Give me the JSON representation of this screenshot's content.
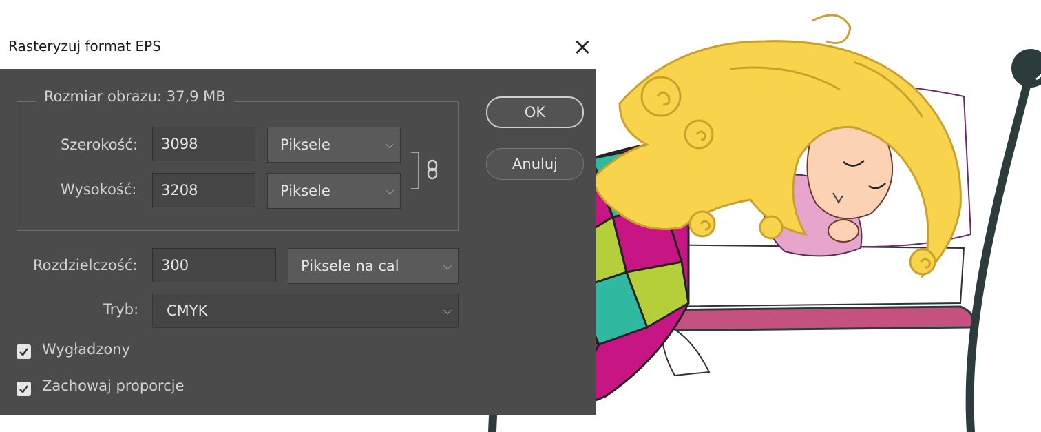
{
  "dialog": {
    "title": "Rasteryzuj format EPS",
    "ok_label": "OK",
    "cancel_label": "Anuluj",
    "image_size_label": "Rozmiar obrazu: 37,9 MB",
    "width": {
      "label": "Szerokość:",
      "value": "3098",
      "unit": "Piksele"
    },
    "height": {
      "label": "Wysokość:",
      "value": "3208",
      "unit": "Piksele"
    },
    "resolution": {
      "label": "Rozdzielczość:",
      "value": "300",
      "unit": "Piksele na cal"
    },
    "mode": {
      "label": "Tryb:",
      "value": "CMYK"
    },
    "anti_aliased": {
      "label": "Wygładzony",
      "checked": true
    },
    "constrain_proportions": {
      "label": "Zachowaj proporcje",
      "checked": true
    }
  },
  "icons": {
    "close": "close-icon",
    "link": "chain-link-icon",
    "dropdown": "chevron-down-icon",
    "check": "checkmark-icon"
  },
  "colors": {
    "dialog_bg": "#4b4b4b",
    "text": "#d2d2d2",
    "field_bg": "#454545",
    "select_bg": "#5a5a5a",
    "checkbox": "#e6e6e6",
    "hair": "#f7d44c",
    "blanket_magenta": "#c71584",
    "blanket_teal": "#2fb9a1",
    "blanket_lime": "#b5cf3a",
    "bed_frame": "#2c3b3b",
    "mattress": "#c45180"
  }
}
